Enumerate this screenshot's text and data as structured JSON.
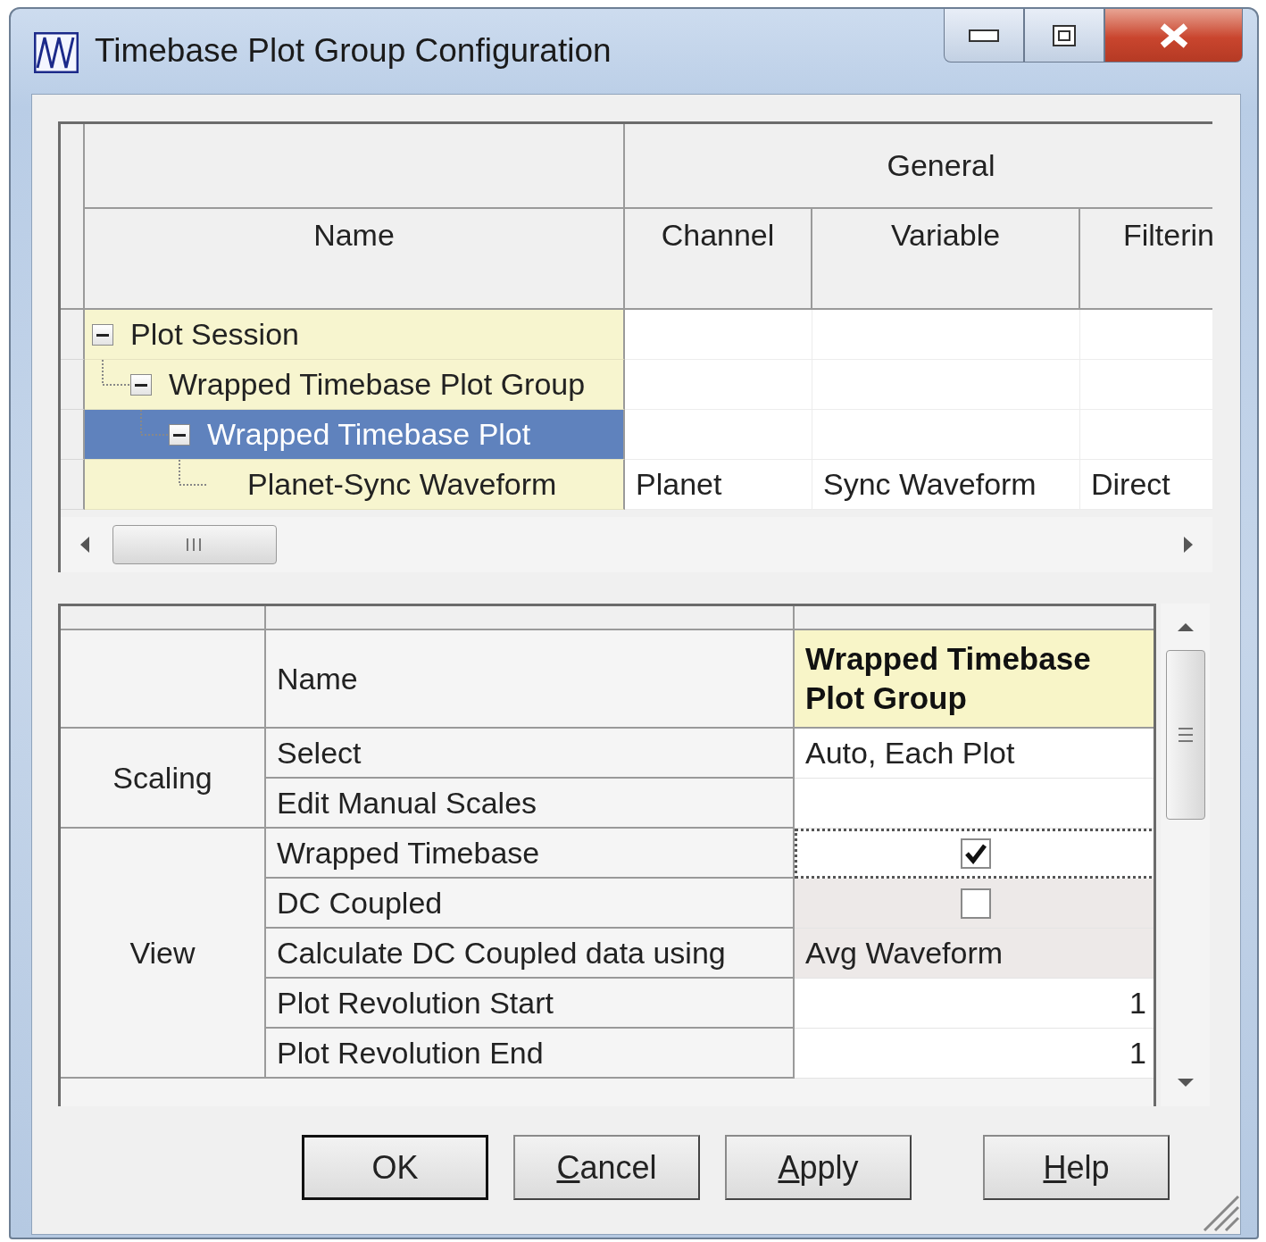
{
  "window": {
    "title": "Timebase Plot Group Configuration"
  },
  "plot_tree": {
    "group_header": "General",
    "columns": [
      "Name",
      "Channel",
      "Variable",
      "Filterin"
    ],
    "nodes": [
      {
        "label": "Plot Session",
        "expanded": true,
        "selected": false,
        "children": [
          {
            "label": "Wrapped Timebase Plot Group",
            "expanded": true,
            "selected": false,
            "children": [
              {
                "label": "Wrapped Timebase Plot",
                "expanded": true,
                "selected": true,
                "children": [
                  {
                    "label": "Planet-Sync Waveform",
                    "selected": false,
                    "cells": [
                      "Planet",
                      "Sync Waveform",
                      "Direct"
                    ]
                  }
                ]
              }
            ]
          }
        ]
      }
    ]
  },
  "properties": {
    "header": {
      "label": "Name",
      "value": "Wrapped Timebase Plot Group"
    },
    "groups": [
      {
        "label": "Scaling",
        "rows": [
          {
            "label": "Select",
            "kind": "text",
            "value": "Auto, Each Plot",
            "readonly": false,
            "focused": false
          },
          {
            "label": "Edit Manual Scales",
            "kind": "text",
            "readonly": false,
            "focused": false
          }
        ]
      },
      {
        "label": "View",
        "rows": [
          {
            "label": "Wrapped Timebase",
            "kind": "check",
            "checked": true,
            "readonly": false,
            "focused": true
          },
          {
            "label": "DC Coupled",
            "kind": "check",
            "checked": false,
            "readonly": true,
            "focused": false
          },
          {
            "label": "Calculate DC Coupled data using",
            "kind": "text",
            "value": "Avg Waveform",
            "readonly": true,
            "focused": false
          },
          {
            "label": "Plot Revolution Start",
            "kind": "number",
            "value": "1",
            "readonly": false,
            "focused": false
          },
          {
            "label": "Plot Revolution End",
            "kind": "number",
            "value": "1",
            "readonly": false,
            "focused": false
          }
        ]
      }
    ]
  },
  "buttons": [
    {
      "label": "OK",
      "default": true,
      "underline_first": false
    },
    {
      "label": "Cancel",
      "default": false,
      "underline_first": true
    },
    {
      "label": "Apply",
      "default": false,
      "underline_first": true
    },
    {
      "label": "Help",
      "default": false,
      "underline_first": true
    }
  ]
}
